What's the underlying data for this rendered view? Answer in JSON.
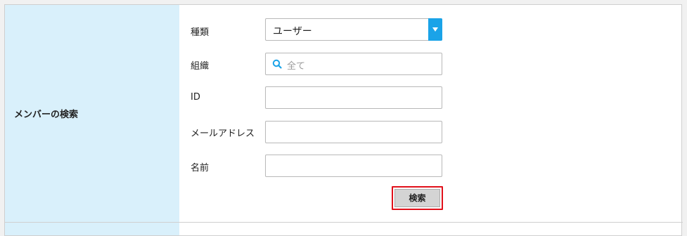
{
  "section": {
    "title": "メンバーの検索"
  },
  "form": {
    "type": {
      "label": "種類",
      "value": "ユーザー"
    },
    "organization": {
      "label": "組織",
      "placeholder": "全て"
    },
    "id": {
      "label": "ID",
      "value": ""
    },
    "email": {
      "label": "メールアドレス",
      "value": ""
    },
    "name": {
      "label": "名前",
      "value": ""
    },
    "search_button": "検索"
  },
  "colors": {
    "side_background": "#d9f0fb",
    "dropdown_accent": "#1aa3e8",
    "highlight_border": "#e0101a"
  },
  "icons": {
    "organization_search": "search-icon",
    "type_dropdown": "chevron-down-icon"
  }
}
